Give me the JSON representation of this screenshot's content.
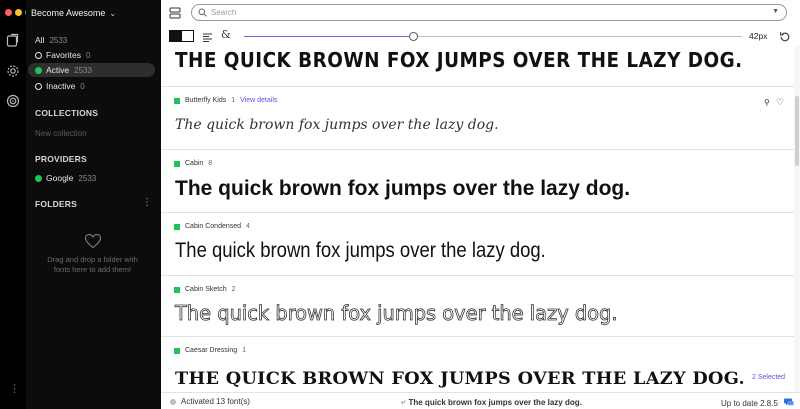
{
  "window": {
    "traffic_lights": [
      "#ff5f57",
      "#febc2e",
      "#28c840"
    ],
    "collection_title": "Become Awesome"
  },
  "rail": {
    "icons": [
      "collections-icon",
      "settings-icon",
      "providers-icon",
      "more-vertical-icon"
    ]
  },
  "sidebar": {
    "filters": [
      {
        "label": "All",
        "count": "2533",
        "marker": "none"
      },
      {
        "label": "Favorites",
        "count": "0",
        "marker": "ring"
      },
      {
        "label": "Active",
        "count": "2533",
        "marker": "dot",
        "active": true
      },
      {
        "label": "Inactive",
        "count": "0",
        "marker": "ring"
      }
    ],
    "collections_heading": "COLLECTIONS",
    "new_collection": "New collection",
    "providers_heading": "PROVIDERS",
    "provider": {
      "label": "Google",
      "count": "2533"
    },
    "folders_heading": "FOLDERS",
    "folders_kebab": "⋮",
    "drop_hint": "Drag and drop a folder with fonts here to add them!",
    "more": "⋮"
  },
  "toolbar": {
    "search_placeholder": "Search",
    "size_value_percent": 34,
    "size_label": "42px",
    "accent": "#7b61d8"
  },
  "fonts": [
    {
      "name": "",
      "count": "",
      "preview": "THE QUICK BROWN FOX JUMPS OVER THE LAZY DOG."
    },
    {
      "name": "Butterfly Kids",
      "count": "1",
      "link": "View details",
      "preview": "The quick brown fox jumps over the lazy dog."
    },
    {
      "name": "Cabin",
      "count": "8",
      "preview": "The quick brown fox jumps over the lazy dog."
    },
    {
      "name": "Cabin Condensed",
      "count": "4",
      "preview": "The quick brown fox jumps over the lazy dog."
    },
    {
      "name": "Cabin Sketch",
      "count": "2",
      "preview": "The quick brown fox jumps over the lazy dog."
    },
    {
      "name": "Caesar Dressing",
      "count": "1",
      "preview": "THE QUICK BROWN FOX JUMPS OVER THE LAZY DOG."
    }
  ],
  "selected_badge": "2 Selected",
  "status": {
    "activated": "Activated 13 font(s)",
    "sample": "The quick brown fox jumps over the lazy dog.",
    "version": "Up to date 2.8.5"
  },
  "colors": {
    "active_green": "#1fc35a",
    "link_purple": "#6a4be0"
  }
}
